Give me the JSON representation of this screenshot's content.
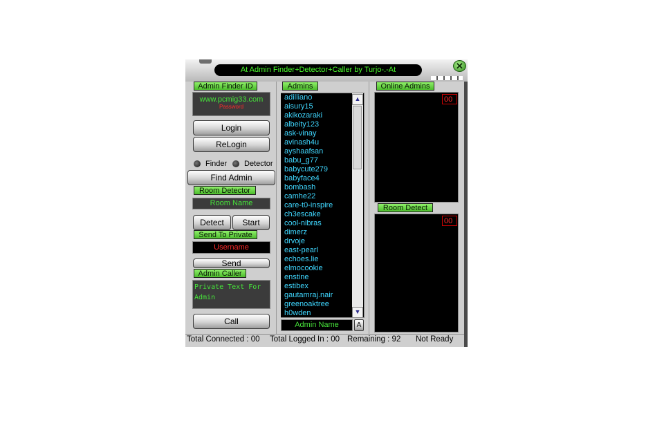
{
  "title": "At Admin Finder+Detector+Caller by Turjo-.-At",
  "close_glyph": "✕",
  "finder_section": {
    "tag": "Admin Finder ID",
    "line1": "www.pcmig33.com",
    "line2": "Password",
    "login": "Login",
    "relogin": "ReLogin",
    "radio_finder": "Finder",
    "radio_detector": "Detector",
    "find_admin": "Find Admin"
  },
  "room_section": {
    "tag": "Room Detector",
    "placeholder": "Room Name",
    "detect": "Detect",
    "start": "Start"
  },
  "private_section": {
    "tag": "Send To Private",
    "placeholder": "Username",
    "send": "Send"
  },
  "caller_section": {
    "tag": "Admin Caller",
    "text": "Private Text For Admin",
    "call": "Call"
  },
  "admins": {
    "tag": "Admins",
    "items": [
      "adilliano",
      "aisury15",
      "akikozaraki",
      "albeity123",
      "ask-vinay",
      "avinash4u",
      "ayshaafsan",
      "babu_g77",
      "babycute279",
      "babyface4",
      "bombash",
      "camhe22",
      "care-t0-inspire",
      "ch3escake",
      "cool-nibras",
      "dimerz",
      "drvoje",
      "east-pearl",
      "echoes.lie",
      "elmocookie",
      "enstine",
      "estibex",
      "gautamraj.nair",
      "greenoaktree",
      "h0wden"
    ],
    "input_placeholder": "Admin Name",
    "add_glyph": "A",
    "scroll_up": "▲",
    "scroll_down": "▼"
  },
  "online_admins": {
    "tag": "Online Admins",
    "count": "00"
  },
  "room_detect": {
    "tag": "Room Detect",
    "count": "00"
  },
  "status": {
    "connected": "Total Connected :   00",
    "logged": "Total Logged In :  00",
    "remaining": "Remaining :   92",
    "state": "Not Ready"
  },
  "colors": {
    "accent_green": "#4cff2e",
    "list_text": "#3fd7ff",
    "alert_red": "#ff2a2a"
  }
}
